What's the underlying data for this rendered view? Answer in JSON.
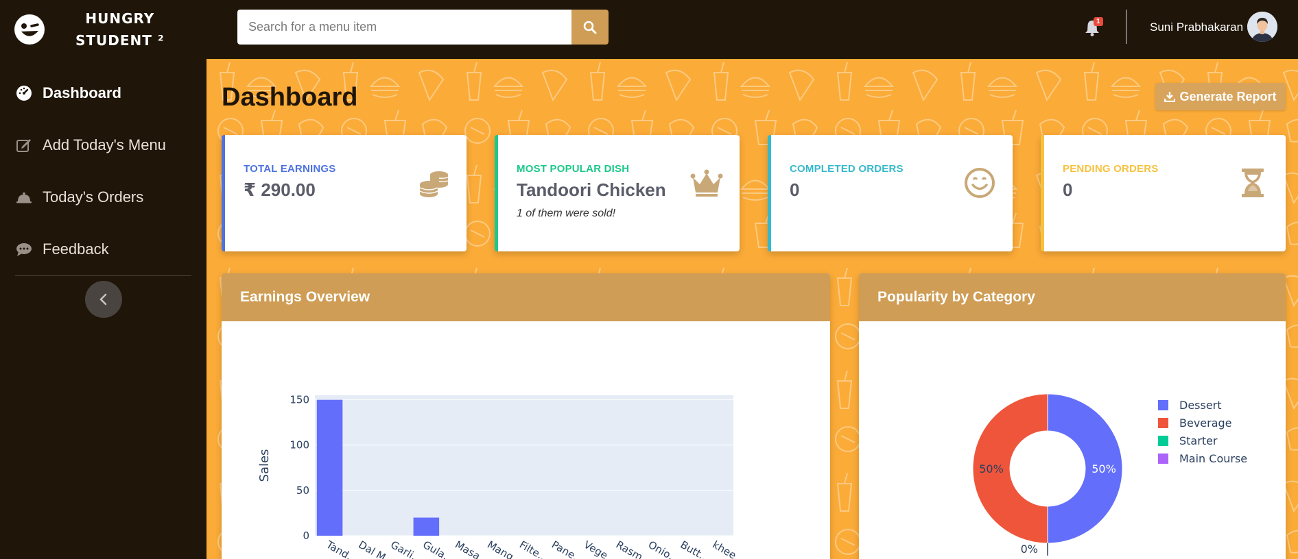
{
  "brand": {
    "line1": "HUNGRY",
    "line2": "STUDENT ²"
  },
  "sidebar": {
    "items": [
      {
        "label": "Dashboard",
        "icon": "tachometer-icon"
      },
      {
        "label": "Add Today's Menu",
        "icon": "edit-icon"
      },
      {
        "label": "Today's Orders",
        "icon": "cloche-icon"
      },
      {
        "label": "Feedback",
        "icon": "comment-icon"
      }
    ]
  },
  "search": {
    "placeholder": "Search for a menu item"
  },
  "topbar": {
    "notification_count": "1",
    "user_name": "Suni Prabhakaran"
  },
  "page": {
    "title": "Dashboard",
    "generate_report": "Generate Report"
  },
  "cards": [
    {
      "label": "Total Earnings",
      "value": "₹ 290.00",
      "color": "#4e73df",
      "icon": "coins-icon"
    },
    {
      "label": "Most Popular Dish",
      "value": "Tandoori Chicken",
      "sub": "1 of them were sold!",
      "color": "#1cc88a",
      "icon": "crown-icon"
    },
    {
      "label": "Completed Orders",
      "value": "0",
      "color": "#36b9cc",
      "icon": "smile-icon"
    },
    {
      "label": "Pending Orders",
      "value": "0",
      "color": "#f6c23e",
      "icon": "hourglass-icon"
    }
  ],
  "colors": {
    "accent": "#cf9d55",
    "background": "#fbab38",
    "sidebar": "#1f1509"
  },
  "panels": {
    "earnings_title": "Earnings Overview",
    "popularity_title": "Popularity by Category"
  },
  "chart_data": [
    {
      "type": "bar",
      "categories": [
        "Tand…",
        "Dal M…",
        "Garli…",
        "Gula…",
        "Masa…",
        "Mang…",
        "Filte…",
        "Pane…",
        "Vege…",
        "Rasm…",
        "Onio…",
        "Butt…",
        "khee…"
      ],
      "values": [
        150,
        0,
        0,
        20,
        0,
        0,
        0,
        0,
        0,
        0,
        0,
        0,
        0
      ],
      "ylabel": "Sales",
      "ylim": [
        0,
        155
      ],
      "yticks": [
        0,
        50,
        100,
        150
      ],
      "grid": true,
      "color": "#636efa"
    },
    {
      "type": "pie",
      "donut": true,
      "labels": [
        "Dessert",
        "Beverage",
        "Starter",
        "Main Course"
      ],
      "values": [
        50,
        50,
        0,
        0
      ],
      "percent_labels": [
        "50%",
        "50%",
        "0%",
        ""
      ],
      "colors": [
        "#636efa",
        "#ef553b",
        "#00cc96",
        "#ab63fa"
      ],
      "legend": "right"
    }
  ]
}
